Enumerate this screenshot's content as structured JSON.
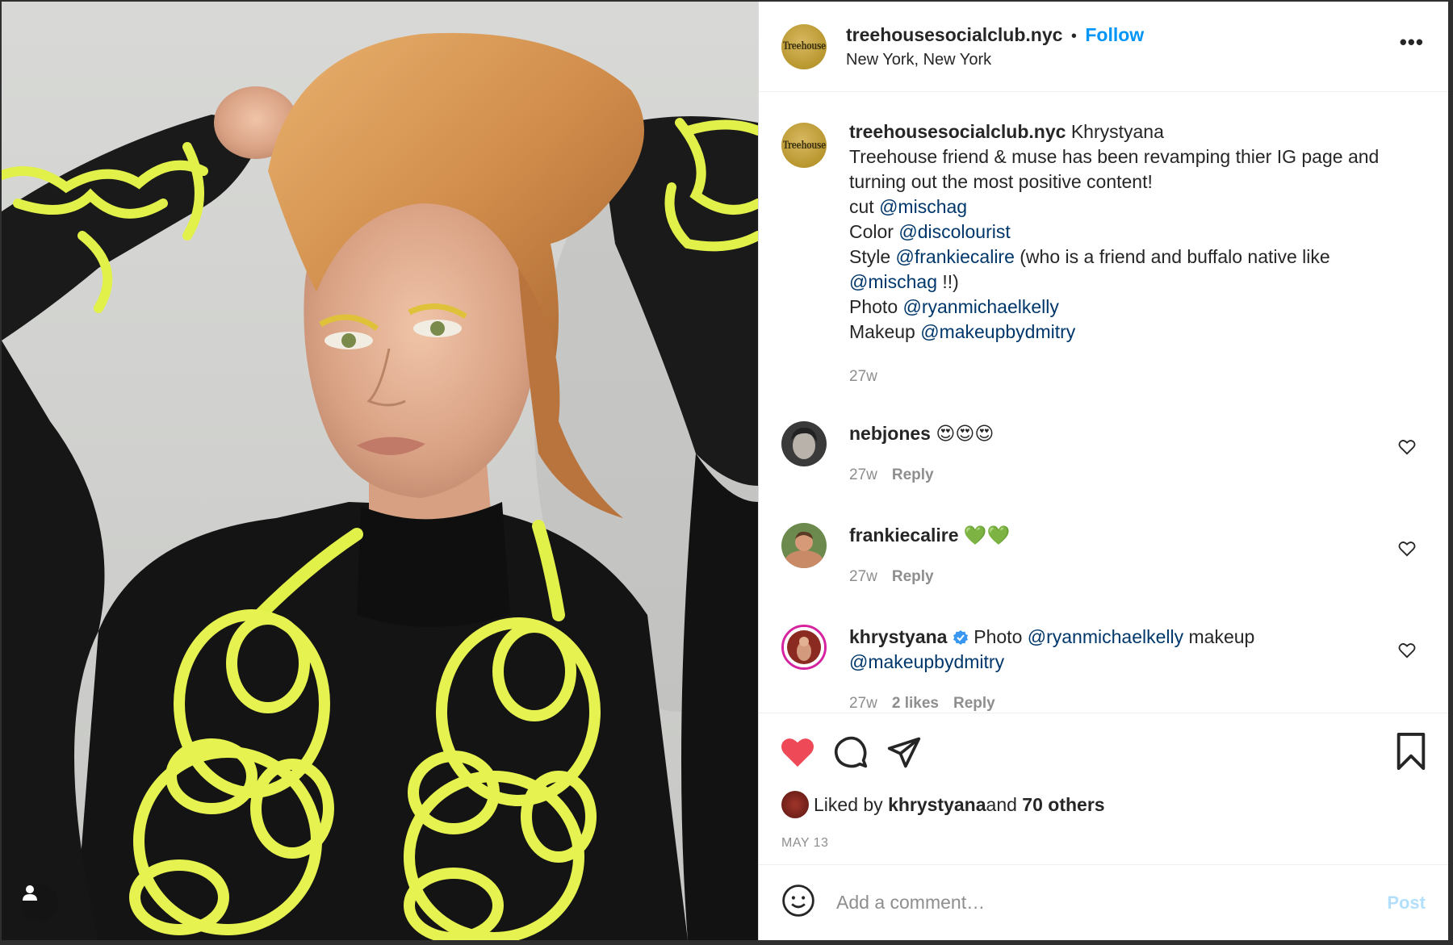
{
  "header": {
    "username": "treehousesocialclub.nyc",
    "separator": "•",
    "follow_label": "Follow",
    "location": "New York, New York",
    "avatar_text": "Treehouse",
    "more_label": "•••"
  },
  "caption": {
    "username": "treehousesocialclub.nyc",
    "lines": [
      {
        "text": "Khrystyana"
      },
      {
        "text": "Treehouse friend & muse has been revamping thier IG page and turning out the most positive content!"
      },
      {
        "prefix": "cut ",
        "mention": "@mischag"
      },
      {
        "prefix": "Color ",
        "mention": "@discolourist"
      },
      {
        "prefix": "Style ",
        "mention": "@frankiecalire",
        "suffix": " (who is a friend and buffalo native like "
      },
      {
        "mention": "@mischag",
        "suffix": " !!)"
      },
      {
        "prefix": "Photo ",
        "mention": "@ryanmichaelkelly"
      },
      {
        "prefix": "Makeup ",
        "mention": "@makeupbydmitry"
      }
    ],
    "time": "27w"
  },
  "comments": [
    {
      "username": "nebjones",
      "text": "😍😍😍",
      "time": "27w",
      "reply_label": "Reply"
    },
    {
      "username": "frankiecalire",
      "text": "💚💚",
      "time": "27w",
      "reply_label": "Reply"
    },
    {
      "username": "khrystyana",
      "prefix": "Photo ",
      "mention1": "@ryanmichaelkelly",
      "middle": " makeup",
      "mention2": "@makeupbydmitry",
      "time": "27w",
      "likes_label": "2 likes",
      "reply_label": "Reply"
    }
  ],
  "likes": {
    "prefix": "Liked by ",
    "user": "khrystyana",
    "middle": " and ",
    "others": "70 others"
  },
  "date": "MAY 13",
  "add_comment": {
    "placeholder": "Add a comment…",
    "post_label": "Post"
  },
  "colors": {
    "follow_blue": "#0095f6",
    "mention_blue": "#00376b",
    "like_red": "#ed4956",
    "post_disabled": "#b2dffc",
    "neon_yellow": "#e2f04a"
  }
}
